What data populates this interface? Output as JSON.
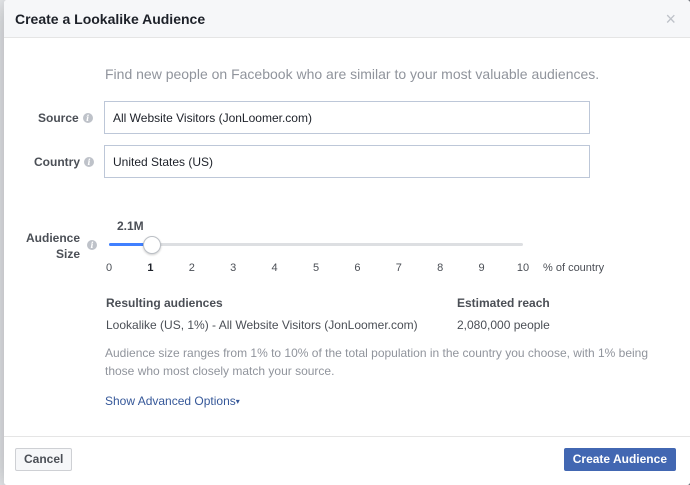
{
  "dialog": {
    "title": "Create a Lookalike Audience",
    "close_symbol": "×",
    "intro": "Find new people on Facebook who are similar to your most valuable audiences."
  },
  "form": {
    "source_label": "Source",
    "source_value": "All Website Visitors (JonLoomer.com)",
    "country_label": "Country",
    "country_value": "United States (US)",
    "size_label_line1": "Audience",
    "size_label_line2": "Size",
    "info_symbol": "i"
  },
  "slider": {
    "reach_label": "2.1M",
    "value": 1,
    "min": 0,
    "max": 10,
    "ticks": [
      "0",
      "1",
      "2",
      "3",
      "4",
      "5",
      "6",
      "7",
      "8",
      "9",
      "10"
    ],
    "unit_label": "% of country",
    "fill_color": "#4080ff"
  },
  "results": {
    "audiences_heading": "Resulting audiences",
    "reach_heading": "Estimated reach",
    "audience_value": "Lookalike (US, 1%) - All Website Visitors (JonLoomer.com)",
    "reach_value": "2,080,000 people"
  },
  "help_text": "Audience size ranges from 1% to 10% of the total population in the country you choose, with 1% being those who most closely match your source.",
  "advanced": {
    "label": "Show Advanced Options",
    "caret": "▾"
  },
  "footer": {
    "cancel_label": "Cancel",
    "create_label": "Create Audience",
    "primary_color": "#4267b2"
  }
}
